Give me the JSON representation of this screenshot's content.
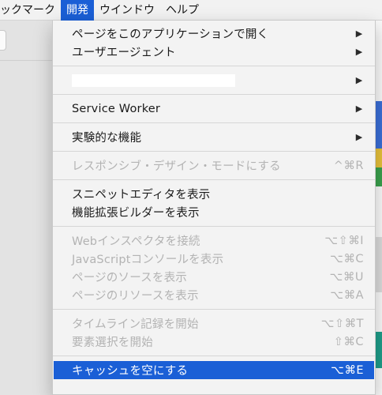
{
  "menubar": {
    "items": [
      {
        "label": "ブックマーク",
        "display": "ックマーク"
      },
      {
        "label": "開発",
        "active": true
      },
      {
        "label": "ウインドウ"
      },
      {
        "label": "ヘルプ"
      }
    ]
  },
  "menu": {
    "groups": [
      [
        {
          "label": "ページをこのアプリケーションで開く",
          "submenu": true
        },
        {
          "label": "ユーザエージェント",
          "submenu": true
        }
      ],
      [
        {
          "label": "",
          "redacted": true,
          "submenu": true
        }
      ],
      [
        {
          "label": "Service Worker",
          "submenu": true
        }
      ],
      [
        {
          "label": "実験的な機能",
          "submenu": true
        }
      ],
      [
        {
          "label": "レスポンシブ・デザイン・モードにする",
          "shortcut": "^⌘R",
          "disabled": true
        }
      ],
      [
        {
          "label": "スニペットエディタを表示"
        },
        {
          "label": "機能拡張ビルダーを表示"
        }
      ],
      [
        {
          "label": "Webインスペクタを接続",
          "shortcut": "⌥⇧⌘I",
          "disabled": true
        },
        {
          "label": "JavaScriptコンソールを表示",
          "shortcut": "⌥⌘C",
          "disabled": true
        },
        {
          "label": "ページのソースを表示",
          "shortcut": "⌥⌘U",
          "disabled": true
        },
        {
          "label": "ページのリソースを表示",
          "shortcut": "⌥⌘A",
          "disabled": true
        }
      ],
      [
        {
          "label": "タイムライン記録を開始",
          "shortcut": "⌥⇧⌘T",
          "disabled": true
        },
        {
          "label": "要素選択を開始",
          "shortcut": "⇧⌘C",
          "disabled": true
        }
      ],
      [
        {
          "label": "キャッシュを空にする",
          "shortcut": "⌥⌘E",
          "selected": true
        }
      ]
    ]
  },
  "submenu_arrow": "▶",
  "colors": {
    "highlight": "#1a5fd6",
    "disabled_text": "#b3b3b3"
  }
}
